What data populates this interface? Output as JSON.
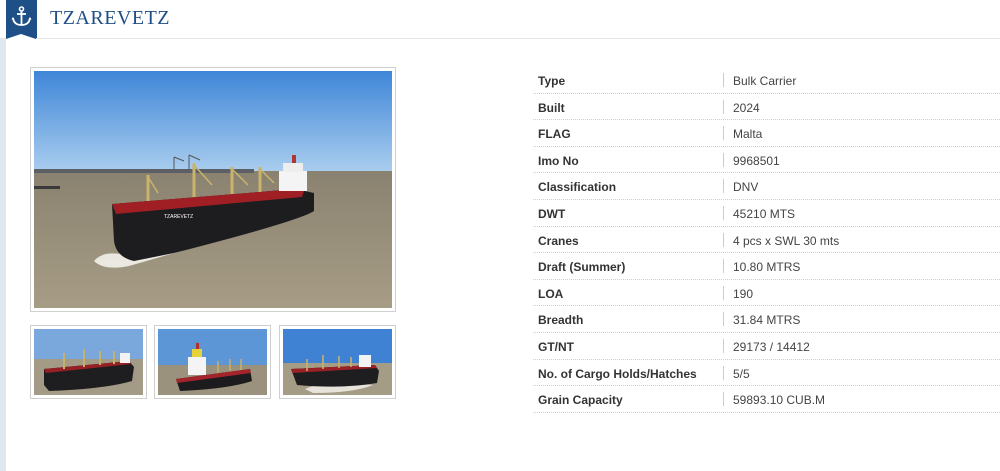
{
  "header": {
    "title": "TZAREVETZ",
    "icon": "anchor-icon",
    "brand_color": "#1e4f86"
  },
  "gallery": {
    "main_image": "ship-photo-main",
    "thumbnails": [
      "ship-photo-thumb-1",
      "ship-photo-thumb-2",
      "ship-photo-thumb-3"
    ]
  },
  "specs": [
    {
      "label": "Type",
      "value": "Bulk Carrier"
    },
    {
      "label": "Built",
      "value": "2024"
    },
    {
      "label": "FLAG",
      "value": "Malta"
    },
    {
      "label": "Imo No",
      "value": "9968501"
    },
    {
      "label": "Classification",
      "value": "DNV"
    },
    {
      "label": "DWT",
      "value": "45210 MTS"
    },
    {
      "label": "Cranes",
      "value": "4 pcs x SWL 30 mts"
    },
    {
      "label": "Draft (Summer)",
      "value": "10.80 MTRS"
    },
    {
      "label": "LOA",
      "value": "190"
    },
    {
      "label": "Breadth",
      "value": "31.84 MTRS"
    },
    {
      "label": "GT/NT",
      "value": "29173 / 14412"
    },
    {
      "label": "No. of Cargo Holds/Hatches",
      "value": "5/5"
    },
    {
      "label": "Grain Capacity",
      "value": "59893.10 CUB.M"
    }
  ]
}
